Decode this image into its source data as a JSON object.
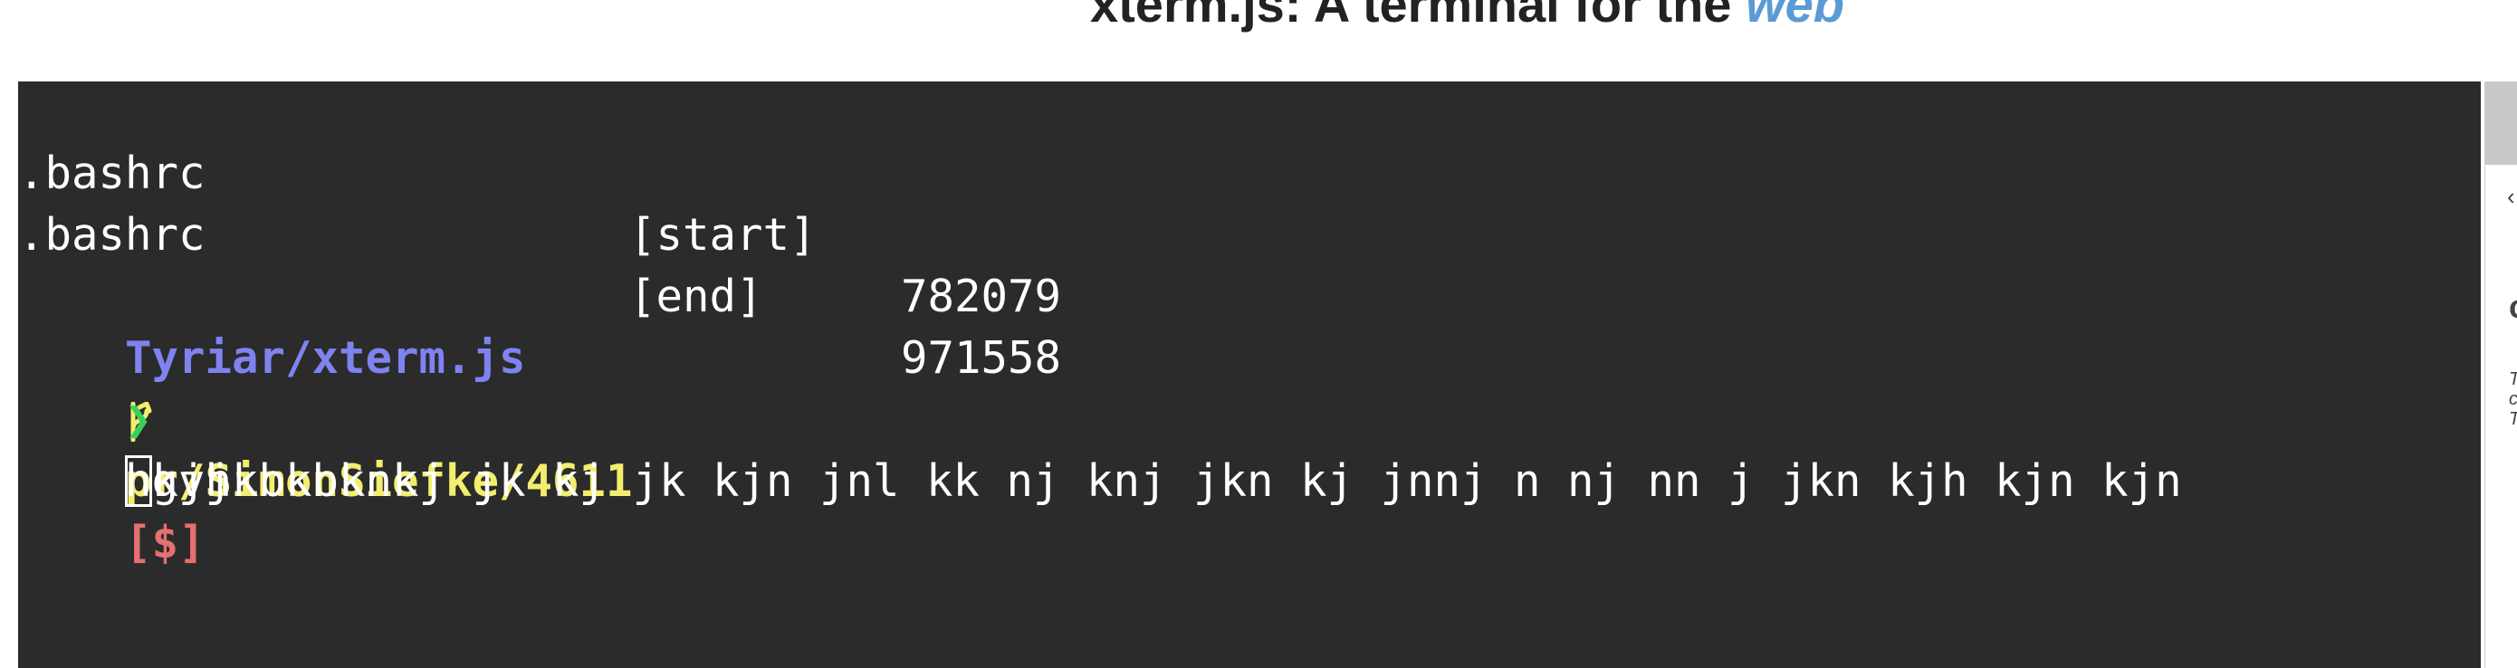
{
  "page": {
    "heading_main": "xterm.js: A terminal for the ",
    "heading_accent": "web"
  },
  "terminal": {
    "lines": [
      {
        "name": ".bashrc",
        "tag": "[start]",
        "value": "782079"
      },
      {
        "name": ".bashrc",
        "tag": "[end]",
        "value": "971558"
      }
    ],
    "prompt": {
      "path": "Tyriar/xterm.js",
      "branch_glyph": "",
      "branch": "pr/SimonSiefke/4611",
      "status": "[$]",
      "chevron": "❯",
      "input_cursor_char": "h",
      "input_rest": "gvjkbkbknkj jk kj jk kjn jnl kk nj knj jkn kj jnnj n nj nn j jkn kjh kjn kjn",
      "input_wrap": " kjh"
    }
  },
  "sidebar": {
    "glyph_1": "‹",
    "glyph_2": "c",
    "glyph_3": "T",
    "glyph_4": "c",
    "glyph_5": "T"
  },
  "colors": {
    "terminal_bg": "#2b2b2b",
    "prompt_path": "#7f83f0",
    "git_branch": "#f2ee6e",
    "git_status": "#e66f6f",
    "chevron": "#38d05a"
  },
  "icons": {
    "branch": "git-branch-icon",
    "prompt": "prompt-chevron-icon"
  }
}
